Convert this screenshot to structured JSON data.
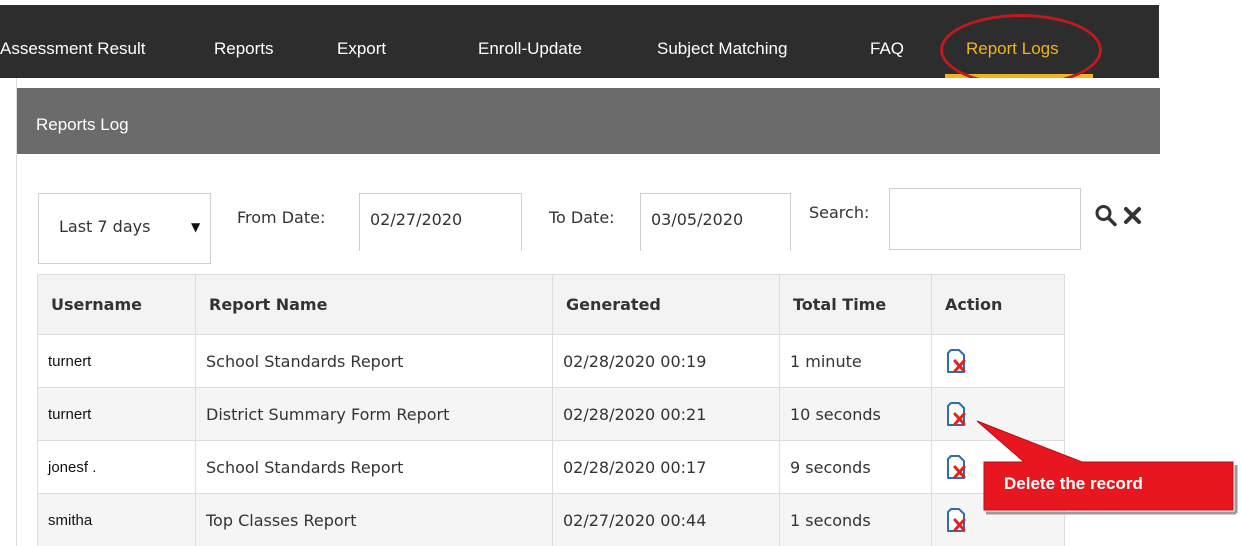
{
  "nav": {
    "items": [
      {
        "label": "Assessment Result"
      },
      {
        "label": "Reports"
      },
      {
        "label": "Export"
      },
      {
        "label": "Enroll-Update"
      },
      {
        "label": "Subject Matching"
      },
      {
        "label": "FAQ"
      },
      {
        "label": "Report Logs"
      }
    ],
    "active": "Report Logs",
    "active_color": "#f0b51e",
    "highlight_color": "#c0191f"
  },
  "panel": {
    "title": "Reports Log"
  },
  "filters": {
    "period": "Last 7 days",
    "from_label": "From Date:",
    "from_value": "02/27/2020",
    "to_label": "To Date:",
    "to_value": "03/05/2020",
    "search_label": "Search:",
    "search_value": ""
  },
  "table": {
    "headers": [
      "Username",
      "Report Name",
      "Generated",
      "Total Time",
      "Action"
    ],
    "rows": [
      {
        "username": "turnert",
        "report": "School Standards Report",
        "generated": "02/28/2020 00:19",
        "total": "1 minute"
      },
      {
        "username": "turnert",
        "report": "District Summary Form Report",
        "generated": "02/28/2020 00:21",
        "total": "10 seconds"
      },
      {
        "username": "jonesf   .",
        "report": "School Standards Report",
        "generated": "02/28/2020 00:17",
        "total": "9 seconds"
      },
      {
        "username": "smitha",
        "report": "Top Classes Report",
        "generated": "02/27/2020 00:44",
        "total": "1 seconds"
      }
    ],
    "action_icon": "delete-file-icon"
  },
  "callout": {
    "text": "Delete the record",
    "color": "#e8161f"
  }
}
